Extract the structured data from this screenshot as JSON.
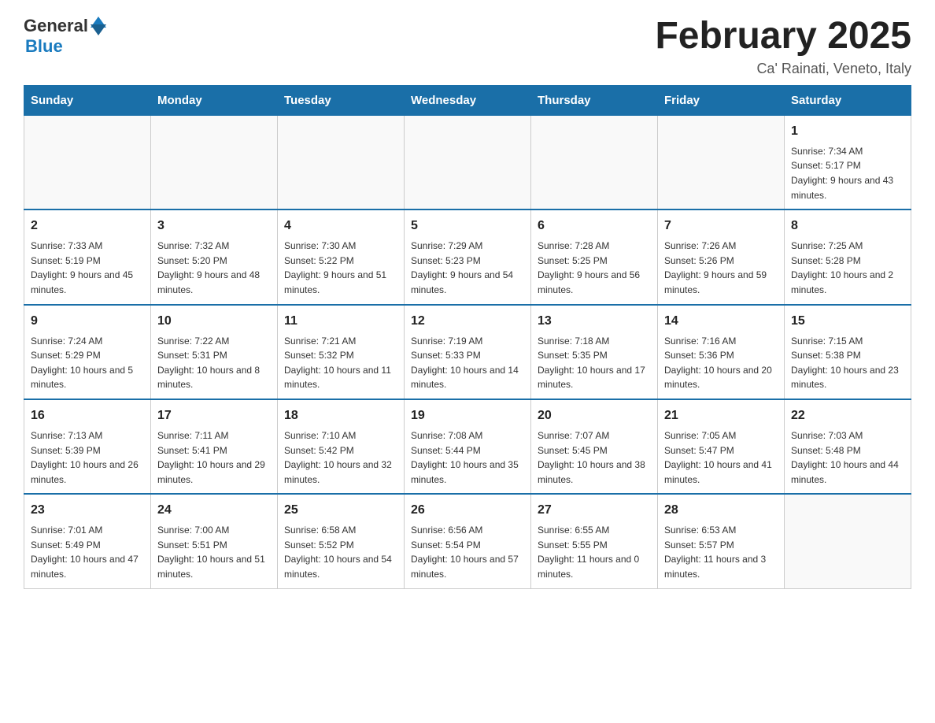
{
  "header": {
    "logo": {
      "general": "General",
      "blue": "Blue"
    },
    "title": "February 2025",
    "subtitle": "Ca' Rainati, Veneto, Italy"
  },
  "weekdays": [
    "Sunday",
    "Monday",
    "Tuesday",
    "Wednesday",
    "Thursday",
    "Friday",
    "Saturday"
  ],
  "weeks": [
    [
      {
        "day": "",
        "info": ""
      },
      {
        "day": "",
        "info": ""
      },
      {
        "day": "",
        "info": ""
      },
      {
        "day": "",
        "info": ""
      },
      {
        "day": "",
        "info": ""
      },
      {
        "day": "",
        "info": ""
      },
      {
        "day": "1",
        "info": "Sunrise: 7:34 AM\nSunset: 5:17 PM\nDaylight: 9 hours and 43 minutes."
      }
    ],
    [
      {
        "day": "2",
        "info": "Sunrise: 7:33 AM\nSunset: 5:19 PM\nDaylight: 9 hours and 45 minutes."
      },
      {
        "day": "3",
        "info": "Sunrise: 7:32 AM\nSunset: 5:20 PM\nDaylight: 9 hours and 48 minutes."
      },
      {
        "day": "4",
        "info": "Sunrise: 7:30 AM\nSunset: 5:22 PM\nDaylight: 9 hours and 51 minutes."
      },
      {
        "day": "5",
        "info": "Sunrise: 7:29 AM\nSunset: 5:23 PM\nDaylight: 9 hours and 54 minutes."
      },
      {
        "day": "6",
        "info": "Sunrise: 7:28 AM\nSunset: 5:25 PM\nDaylight: 9 hours and 56 minutes."
      },
      {
        "day": "7",
        "info": "Sunrise: 7:26 AM\nSunset: 5:26 PM\nDaylight: 9 hours and 59 minutes."
      },
      {
        "day": "8",
        "info": "Sunrise: 7:25 AM\nSunset: 5:28 PM\nDaylight: 10 hours and 2 minutes."
      }
    ],
    [
      {
        "day": "9",
        "info": "Sunrise: 7:24 AM\nSunset: 5:29 PM\nDaylight: 10 hours and 5 minutes."
      },
      {
        "day": "10",
        "info": "Sunrise: 7:22 AM\nSunset: 5:31 PM\nDaylight: 10 hours and 8 minutes."
      },
      {
        "day": "11",
        "info": "Sunrise: 7:21 AM\nSunset: 5:32 PM\nDaylight: 10 hours and 11 minutes."
      },
      {
        "day": "12",
        "info": "Sunrise: 7:19 AM\nSunset: 5:33 PM\nDaylight: 10 hours and 14 minutes."
      },
      {
        "day": "13",
        "info": "Sunrise: 7:18 AM\nSunset: 5:35 PM\nDaylight: 10 hours and 17 minutes."
      },
      {
        "day": "14",
        "info": "Sunrise: 7:16 AM\nSunset: 5:36 PM\nDaylight: 10 hours and 20 minutes."
      },
      {
        "day": "15",
        "info": "Sunrise: 7:15 AM\nSunset: 5:38 PM\nDaylight: 10 hours and 23 minutes."
      }
    ],
    [
      {
        "day": "16",
        "info": "Sunrise: 7:13 AM\nSunset: 5:39 PM\nDaylight: 10 hours and 26 minutes."
      },
      {
        "day": "17",
        "info": "Sunrise: 7:11 AM\nSunset: 5:41 PM\nDaylight: 10 hours and 29 minutes."
      },
      {
        "day": "18",
        "info": "Sunrise: 7:10 AM\nSunset: 5:42 PM\nDaylight: 10 hours and 32 minutes."
      },
      {
        "day": "19",
        "info": "Sunrise: 7:08 AM\nSunset: 5:44 PM\nDaylight: 10 hours and 35 minutes."
      },
      {
        "day": "20",
        "info": "Sunrise: 7:07 AM\nSunset: 5:45 PM\nDaylight: 10 hours and 38 minutes."
      },
      {
        "day": "21",
        "info": "Sunrise: 7:05 AM\nSunset: 5:47 PM\nDaylight: 10 hours and 41 minutes."
      },
      {
        "day": "22",
        "info": "Sunrise: 7:03 AM\nSunset: 5:48 PM\nDaylight: 10 hours and 44 minutes."
      }
    ],
    [
      {
        "day": "23",
        "info": "Sunrise: 7:01 AM\nSunset: 5:49 PM\nDaylight: 10 hours and 47 minutes."
      },
      {
        "day": "24",
        "info": "Sunrise: 7:00 AM\nSunset: 5:51 PM\nDaylight: 10 hours and 51 minutes."
      },
      {
        "day": "25",
        "info": "Sunrise: 6:58 AM\nSunset: 5:52 PM\nDaylight: 10 hours and 54 minutes."
      },
      {
        "day": "26",
        "info": "Sunrise: 6:56 AM\nSunset: 5:54 PM\nDaylight: 10 hours and 57 minutes."
      },
      {
        "day": "27",
        "info": "Sunrise: 6:55 AM\nSunset: 5:55 PM\nDaylight: 11 hours and 0 minutes."
      },
      {
        "day": "28",
        "info": "Sunrise: 6:53 AM\nSunset: 5:57 PM\nDaylight: 11 hours and 3 minutes."
      },
      {
        "day": "",
        "info": ""
      }
    ]
  ]
}
